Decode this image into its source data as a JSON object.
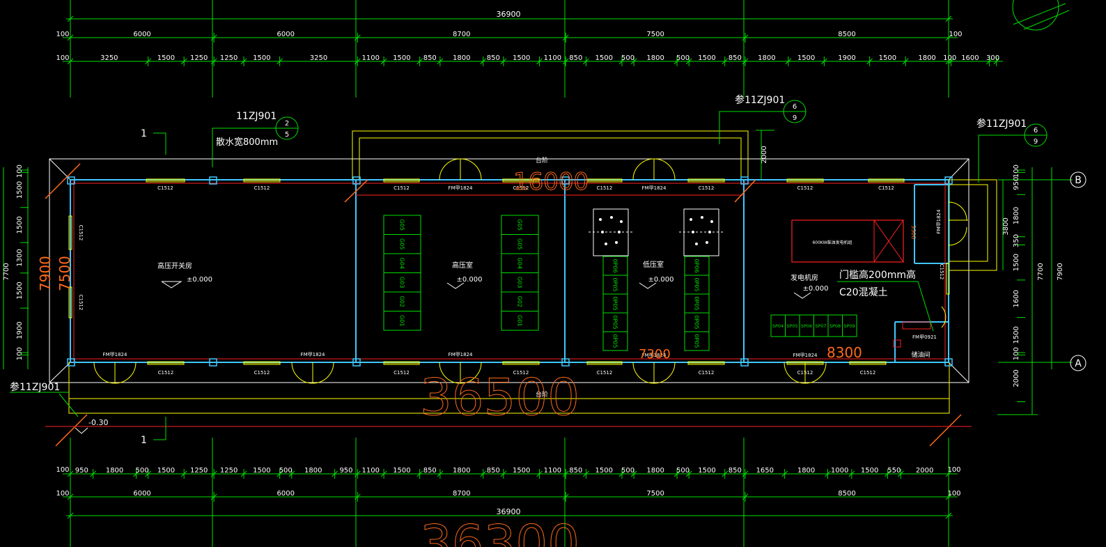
{
  "colors": {
    "background": "#000000",
    "dimension": "#00e000",
    "wall": "#40c8ff",
    "outline": "#ffffff",
    "yellow": "#ffff00",
    "red": "#ff2020",
    "orange": "#ff6a1a",
    "text": "#ffffff"
  },
  "dims": {
    "top_total": "36900",
    "top_bays": [
      "6000",
      "6000",
      "8700",
      "7500",
      "8500"
    ],
    "top_detail": [
      "3250",
      "1500",
      "1250",
      "1250",
      "1500",
      "3250",
      "1100",
      "1500",
      "850",
      "1800",
      "850",
      "1500",
      "1100",
      "850",
      "1500",
      "500",
      "1800",
      "500",
      "1500",
      "850",
      "1800",
      "1500",
      "1900",
      "1500",
      "1800",
      "100",
      "1600",
      "300"
    ],
    "bottom_detail": [
      "950",
      "1800",
      "500",
      "1500",
      "1250",
      "1250",
      "1500",
      "500",
      "1800",
      "950",
      "1100",
      "1500",
      "850",
      "1800",
      "850",
      "1500",
      "1100",
      "850",
      "1500",
      "500",
      "1800",
      "500",
      "1500",
      "850",
      "1650",
      "1800",
      "1000",
      "1500",
      "550",
      "2000"
    ],
    "bottom_bays": [
      "6000",
      "6000",
      "8700",
      "7500",
      "8500"
    ],
    "bottom_total": "36900",
    "end_100": "100",
    "left_v": [
      "100",
      "1500",
      "1500",
      "1300",
      "1500",
      "1900",
      "100"
    ],
    "left_overall": "7700",
    "right_v": [
      "100",
      "950",
      "1800",
      "350",
      "1500",
      "1600",
      "1500",
      "100",
      "2000"
    ],
    "right_overall_a": "7700",
    "right_overall_b": "7900",
    "right_entry_3800": "3800",
    "step_2000": "2000",
    "entry_3300": "3300"
  },
  "annotations": {
    "ref_11zj901": "11ZJ901",
    "ref_2": "2",
    "ref_5": "5",
    "ref_can_11zj901": "参11ZJ901",
    "ref_6": "6",
    "ref_9": "9",
    "apron_note": "散水宽800mm",
    "label_1": "1",
    "label_1b": "1",
    "ref_can_left": "参11ZJ901",
    "level_minus": "-0.30",
    "threshold_note": "门槛高200mm高",
    "concrete_note": "C20混凝土",
    "taijie_top": "台阶",
    "taijie_bottom": "台阶"
  },
  "orange_dims": {
    "d16000": "16000",
    "d36500": "36500",
    "d36300": "36300",
    "d7900": "7900",
    "d7500": "7500",
    "d7300": "7300",
    "d8300": "8300"
  },
  "rooms": {
    "hv_switch": "高压开关房",
    "hv_room": "高压室",
    "lv_room": "低压室",
    "gen_room": "发电机房",
    "oil_room": "储油间",
    "level": "±0.000",
    "generator": "600KW柴油发电机组"
  },
  "windows": {
    "c1512": "C1512"
  },
  "doors": {
    "fm1824": "FM甲1824",
    "fm0921": "FM甲0921"
  },
  "axes": {
    "b": "B",
    "a": "A"
  },
  "cabinets": {
    "g_set": [
      "G05",
      "G05",
      "G04",
      "G03",
      "G02",
      "G01"
    ],
    "lv_set": [
      "0P06",
      "0P05",
      "0P05",
      "0P05",
      "0P05"
    ],
    "sp_set": [
      "SP04",
      "SP05",
      "SP06",
      "SP07",
      "SP08",
      "SP09"
    ]
  }
}
